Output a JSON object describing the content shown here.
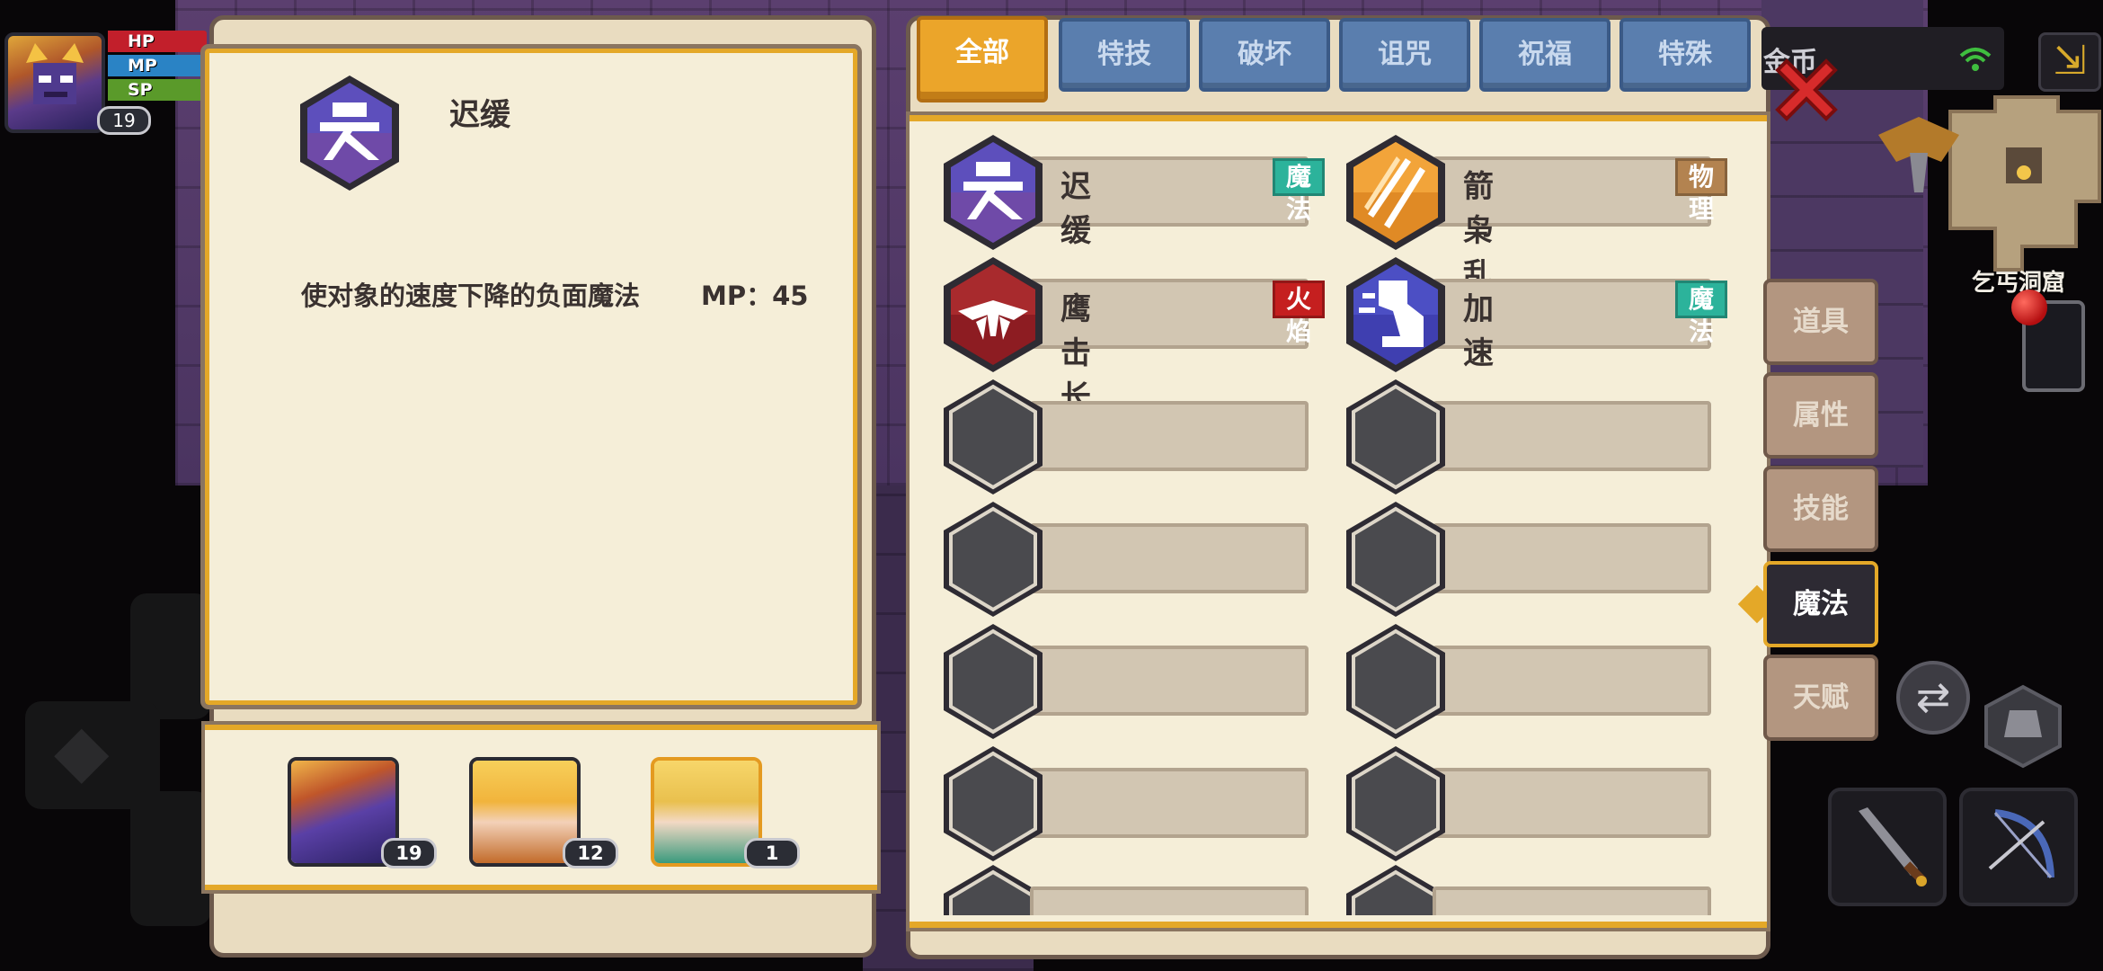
{
  "hud": {
    "hp_label": "HP",
    "mp_label": "MP",
    "sp_label": "SP",
    "level": "19"
  },
  "info_panel": {
    "skill_name": "迟缓",
    "description": "使对象的速度下降的负面魔法",
    "mp_cost": "MP：45",
    "skill_icon": "slow-skill-icon"
  },
  "party": [
    {
      "name": "demon-knight",
      "level": "19",
      "selected": false
    },
    {
      "name": "blonde-hero",
      "level": "12",
      "selected": false
    },
    {
      "name": "blonde-mage",
      "level": "1",
      "selected": true
    }
  ],
  "tabs": [
    {
      "label": "全部",
      "active": true
    },
    {
      "label": "特技",
      "active": false
    },
    {
      "label": "破坏",
      "active": false
    },
    {
      "label": "诅咒",
      "active": false
    },
    {
      "label": "祝福",
      "active": false
    },
    {
      "label": "特殊",
      "active": false
    }
  ],
  "skills": [
    {
      "name": "迟缓",
      "tag": "魔法",
      "tag_color": "#2cb39b",
      "icon": "slow-icon"
    },
    {
      "name": "箭枭乱舞",
      "tag": "物理",
      "tag_color": "#b38350",
      "icon": "arrow-storm-icon"
    },
    {
      "name": "鹰击长空",
      "tag": "火焰",
      "tag_color": "#c51f1f",
      "icon": "eagle-strike-icon"
    },
    {
      "name": "加速",
      "tag": "魔法",
      "tag_color": "#2cb39b",
      "icon": "haste-icon"
    }
  ],
  "side_menu": [
    {
      "label": "道具",
      "active": false
    },
    {
      "label": "属性",
      "active": false
    },
    {
      "label": "技能",
      "active": false
    },
    {
      "label": "魔法",
      "active": true
    },
    {
      "label": "天赋",
      "active": false
    }
  ],
  "top_bar_text": "金币",
  "location": "乞丐洞窟",
  "icons": {
    "close": "close-icon",
    "wifi": "wifi-icon",
    "corner": "exit-icon",
    "swap": "swap-icon",
    "sword": "sword-icon",
    "bow": "bow-icon",
    "phone": "phone-icon"
  }
}
